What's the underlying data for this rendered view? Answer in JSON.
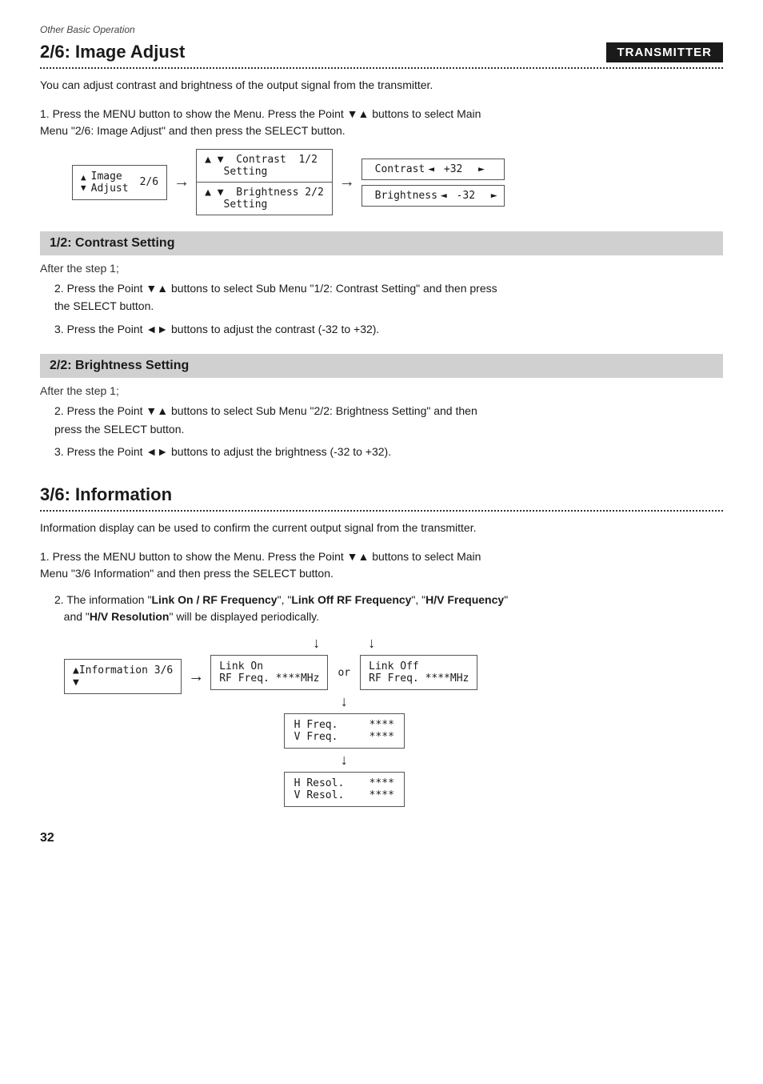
{
  "page": {
    "header": "Other Basic Operation",
    "page_number": "32"
  },
  "section_image_adjust": {
    "title": "2/6: Image Adjust",
    "badge": "TRANSMITTER",
    "description": "You can adjust contrast and brightness of the output signal from the transmitter.",
    "step1": "1. Press the MENU button to show the Menu. Press the Point ▼▲ buttons to select Main\n   Menu \"2/6: Image Adjust\" and then press the SELECT button.",
    "menu_box": {
      "up_arrow": "▲",
      "down_arrow": "▼",
      "label": "Image\nAdjust",
      "number": "2/6"
    },
    "sub_menu": {
      "row1": {
        "up": "▲",
        "text": "Contrast",
        "sub": "Setting",
        "num": "1/2"
      },
      "row2": {
        "down": "▼",
        "text": "Brightness",
        "sub": "Setting",
        "num": "2/2"
      }
    },
    "value_contrast": {
      "label": "Contrast",
      "left_arrow": "◄",
      "value": "+32",
      "right_arrow": "►"
    },
    "value_brightness": {
      "label": "Brightness",
      "left_arrow": "◄",
      "value": "-32",
      "right_arrow": "►"
    }
  },
  "section_contrast": {
    "title": "1/2: Contrast Setting",
    "after_step": "After the step 1;",
    "step2": "2. Press the Point ▼▲ buttons to select Sub Menu \"1/2: Contrast Setting\" and then press\n   the SELECT button.",
    "step3": "3. Press the Point ◄► buttons to adjust the contrast (-32  to +32)."
  },
  "section_brightness": {
    "title": "2/2: Brightness Setting",
    "after_step": "After the step 1;",
    "step2": "2. Press the Point ▼▲ buttons to select Sub Menu \"2/2: Brightness Setting\" and then\n   press the SELECT button.",
    "step3": "3. Press the Point ◄► buttons to adjust the brightness (-32  to +32)."
  },
  "section_information": {
    "title": "3/6: Information",
    "description": "Information display can be used to confirm the current output signal from the transmitter.",
    "step1": "1. Press the MENU button to show the Menu. Press the Point ▼▲ buttons to select Main\n   Menu \"3/6 Information\"  and then press the SELECT button.",
    "step2_prefix": "2. The information \"",
    "step2_bold1": "Link On / RF Frequency",
    "step2_mid1": "\", \"",
    "step2_bold2": "Link Off RF Frequency",
    "step2_mid2": "\", \"",
    "step2_bold3": "H/V Frequency",
    "step2_mid3": "\"\n   and \"",
    "step2_bold4": "H/V Resolution",
    "step2_suffix": "\" will be displayed periodically.",
    "menu_box": {
      "up": "▲",
      "label": "Information",
      "num": "3/6",
      "down": "▼"
    },
    "link_on_box": {
      "line1": "Link On",
      "line2": "RF Freq. ****MHz"
    },
    "or_text": "or",
    "link_off_box": {
      "line1": "Link Off",
      "line2": "RF Freq. ****MHz"
    },
    "hv_freq_box": {
      "h_label": "H Freq.",
      "h_val": "****",
      "v_label": "V Freq.",
      "v_val": "****"
    },
    "hv_resol_box": {
      "h_label": "H Resol.",
      "h_val": "****",
      "v_label": "V Resol.",
      "v_val": "****"
    }
  }
}
